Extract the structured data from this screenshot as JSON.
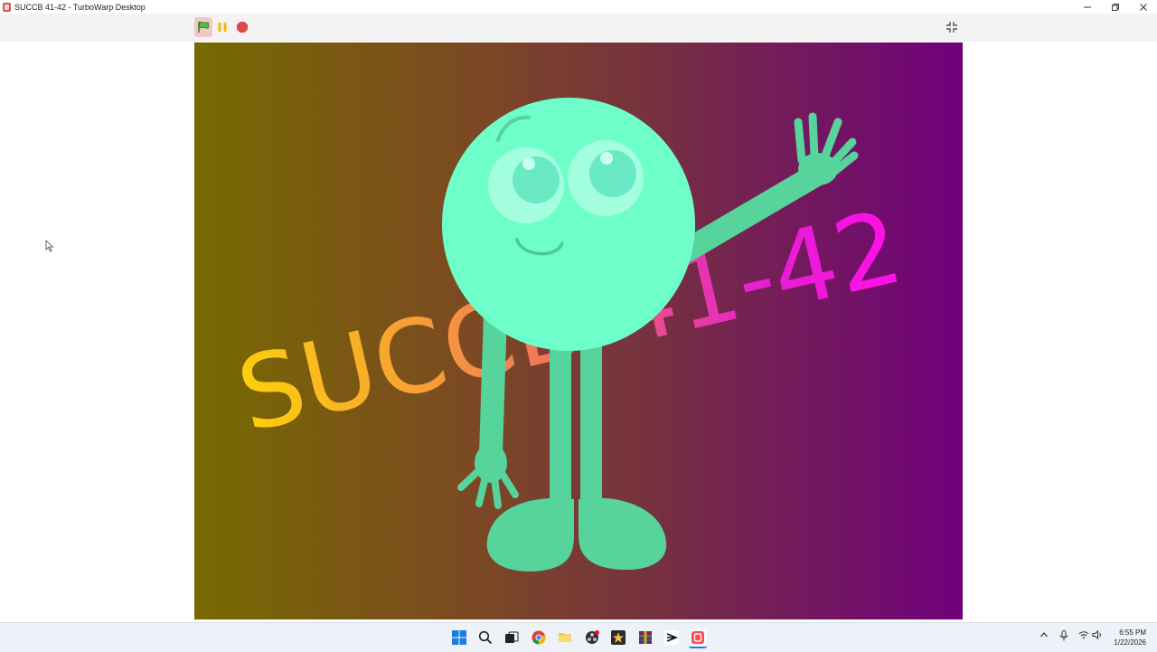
{
  "window": {
    "title": "SUCCB 41-42 - TurboWarp Desktop",
    "minimize_icon": "minimize-icon",
    "maximize_icon": "restore-icon",
    "close_icon": "close-icon"
  },
  "controls": {
    "green_flag": "green-flag-icon",
    "pause": "pause-icon",
    "stop": "stop-icon",
    "fullscreen": "exit-fullscreen-icon"
  },
  "stage": {
    "text": "SUCCB 41-42",
    "colors": {
      "bg_left": "#786a00",
      "bg_right": "#70007d",
      "character": "#6dfec9",
      "limbs": "#57d39c"
    }
  },
  "taskbar": {
    "icons": [
      "windows-start-icon",
      "search-icon",
      "task-view-icon",
      "chrome-icon",
      "file-explorer-icon",
      "obs-icon",
      "app-star-icon",
      "winrar-icon",
      "capcut-icon",
      "turbowarp-icon"
    ],
    "tray": [
      "chevron-up-icon",
      "microphone-icon",
      "wifi-icon",
      "volume-icon"
    ],
    "time": "6:55 PM",
    "date": "1/22/2026"
  }
}
